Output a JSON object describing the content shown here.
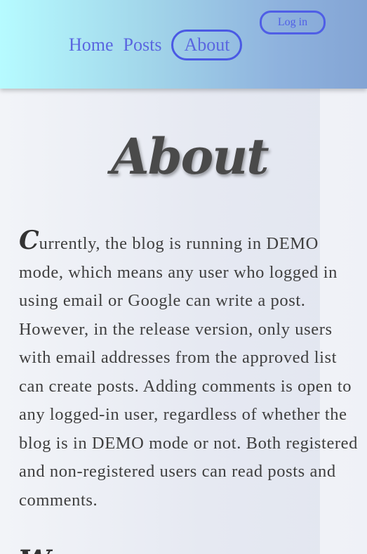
{
  "header": {
    "login_label": "Log in",
    "nav": [
      {
        "label": "Home"
      },
      {
        "label": "Posts"
      },
      {
        "label": "About",
        "active": true
      }
    ]
  },
  "main": {
    "title": "About",
    "paragraph": {
      "drop_cap": "C",
      "text": "urrently, the blog is running in DEMO mode, which means any user who logged in using email or Google can write a post. However, in the release version, only users with email addresses from the approved list can create posts. Adding comments is open to any logged-in user, regardless of whether the blog is in DEMO mode or not. Both registered and non-registered users can read posts and comments."
    },
    "next_heading_partial": "W"
  },
  "colors": {
    "accent": "#4f5ee6",
    "header_gradient_start": "#b6fbff",
    "header_gradient_end": "#83a4d4",
    "title_text": "#4a4a4a",
    "body_text": "#3e3e3e"
  }
}
